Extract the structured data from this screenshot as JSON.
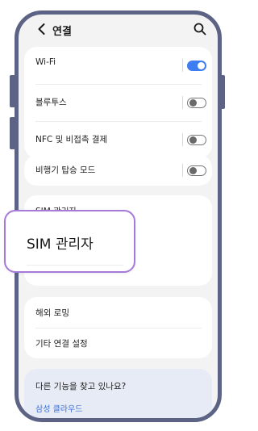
{
  "header": {
    "title": "연결",
    "back_icon": "chevron-left-icon",
    "search_icon": "search-icon"
  },
  "sections": {
    "wireless": {
      "wifi": {
        "label": "Wi-Fi",
        "enabled": true
      },
      "bluetooth": {
        "label": "블루투스",
        "enabled": false
      },
      "nfc": {
        "label": "NFC 및 비접촉 결제",
        "enabled": false
      }
    },
    "airplane": {
      "label": "비행기 탑승 모드",
      "enabled": false
    },
    "sim": {
      "label": "SIM 관리자"
    },
    "more": {
      "roaming": {
        "label": "해외 로밍"
      },
      "other": {
        "label": "기타 연결 설정"
      }
    },
    "suggestion": {
      "question": "다른 기능을 찾고 있나요?",
      "link": "삼성 클라우드"
    }
  },
  "callout": {
    "label": "SIM 관리자"
  },
  "colors": {
    "accent": "#3e7cf2",
    "frame": "#5c6384",
    "highlight": "#a57ad8",
    "link": "#3a6fd8"
  }
}
